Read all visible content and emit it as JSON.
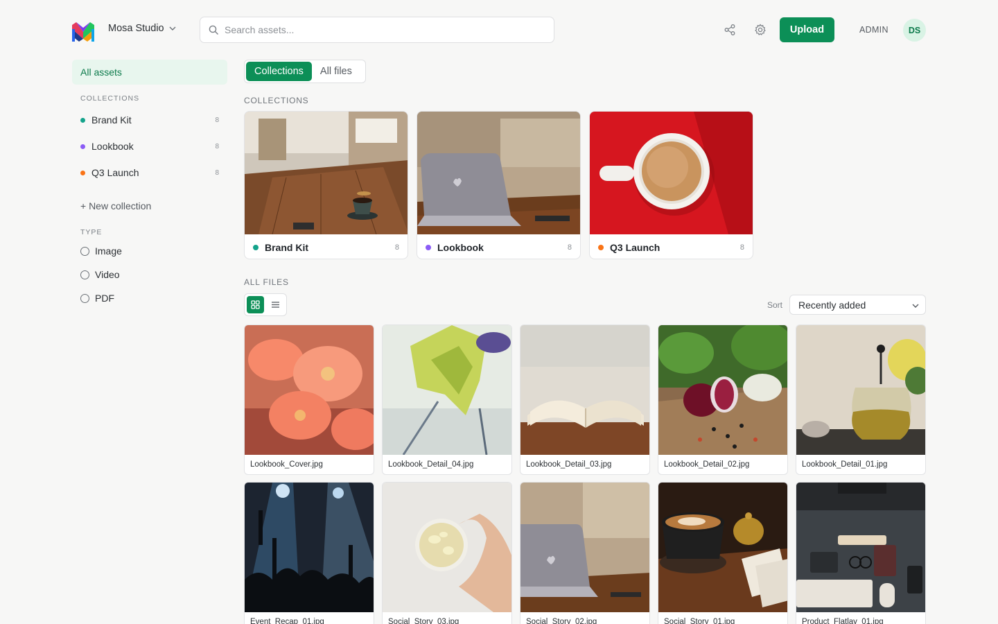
{
  "header": {
    "org_name": "Mosa Studio",
    "search_placeholder": "Search assets...",
    "upload_label": "Upload",
    "role": "ADMIN",
    "avatar_initials": "DS",
    "icons": [
      "logo-icon",
      "chevron-down-icon",
      "search-icon",
      "share-icon",
      "gear-icon"
    ]
  },
  "sidebar": {
    "all_assets": "All assets",
    "collections_heading": "COLLECTIONS",
    "collections": [
      {
        "label": "Brand Kit",
        "count": "8",
        "color": "#14a38b"
      },
      {
        "label": "Lookbook",
        "count": "8",
        "color": "#8b5cf6"
      },
      {
        "label": "Q3 Launch",
        "count": "8",
        "color": "#f97316"
      }
    ],
    "new_collection": "+ New collection",
    "type_heading": "TYPE",
    "types": [
      "Image",
      "Video",
      "PDF"
    ]
  },
  "main": {
    "tabs": [
      "Collections",
      "All files"
    ],
    "collections_heading": "COLLECTIONS",
    "collection_cards": [
      {
        "label": "Brand Kit",
        "count": "8",
        "color": "#14a38b"
      },
      {
        "label": "Lookbook",
        "count": "8",
        "color": "#8b5cf6"
      },
      {
        "label": "Q3 Launch",
        "count": "8",
        "color": "#f97316"
      }
    ],
    "all_files_heading": "ALL FILES",
    "sort_label": "Sort",
    "sort_value": "Recently added",
    "files": [
      "Lookbook_Cover.jpg",
      "Lookbook_Detail_04.jpg",
      "Lookbook_Detail_03.jpg",
      "Lookbook_Detail_02.jpg",
      "Lookbook_Detail_01.jpg",
      "Event_Recap_01.jpg",
      "Social_Story_03.jpg",
      "Social_Story_02.jpg",
      "Social_Story_01.jpg",
      "Product_Flatlay_01.jpg"
    ],
    "accent": "#0c8f57"
  }
}
